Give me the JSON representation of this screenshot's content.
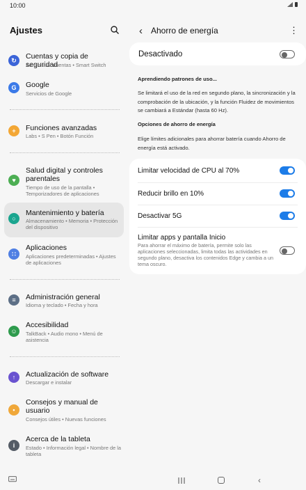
{
  "status": {
    "time": "10:00"
  },
  "left": {
    "title": "Ajustes",
    "items": [
      {
        "title": "Cuentas y copia de seguridad",
        "sub": "Administrar cuentas  •  Smart Switch",
        "color": "#3b64d8",
        "icon": "sync-icon"
      },
      {
        "title": "Google",
        "sub": "Servicios de Google",
        "color": "#3b7ae8",
        "icon": "google-icon"
      },
      {
        "title": "Funciones avanzadas",
        "sub": "Labs  •  S Pen  •  Botón Función",
        "color": "#f3a735",
        "icon": "gear-plus-icon"
      },
      {
        "title": "Salud digital y controles parentales",
        "sub": "Tiempo de uso de la pantalla  •  Temporizadores de aplicaciones",
        "color": "#4cae53",
        "icon": "heart-icon"
      },
      {
        "title": "Mantenimiento y batería",
        "sub": "Almacenamiento  •  Memoria  •  Protección del dispositivo",
        "color": "#1aa58f",
        "icon": "refresh-icon"
      },
      {
        "title": "Aplicaciones",
        "sub": "Aplicaciones predeterminadas  •  Ajustes de aplicaciones",
        "color": "#4f7fe3",
        "icon": "apps-grid-icon"
      },
      {
        "title": "Administración general",
        "sub": "Idioma y teclado  •  Fecha y hora",
        "color": "#5d6f86",
        "icon": "sliders-icon"
      },
      {
        "title": "Accesibilidad",
        "sub": "TalkBack  •  Audio mono  •  Menú de asistencia",
        "color": "#2e9b4d",
        "icon": "accessibility-icon"
      },
      {
        "title": "Actualización de software",
        "sub": "Descargar e instalar",
        "color": "#6a53d0",
        "icon": "software-update-icon"
      },
      {
        "title": "Consejos y manual de usuario",
        "sub": "Consejos útiles  •  Nuevas funciones",
        "color": "#f0a83a",
        "icon": "lightbulb-icon"
      },
      {
        "title": "Acerca de la tableta",
        "sub": "Estado  •  Información legal  •  Nombre de la tableta",
        "color": "#555c66",
        "icon": "info-icon"
      }
    ]
  },
  "right": {
    "title": "Ahorro de energía",
    "master_label": "Desactivado",
    "learning_head": "Aprendiendo patrones de uso...",
    "learning_text": "Se limitará el uso de la red en segundo plano, la sincronización y la comprobación de la ubicación, y la función Fluidez de movimientos se cambiará a Estándar (hasta 60 Hz).",
    "options_head": "Opciones de ahorro de energía",
    "options_text": "Elige límites adicionales para ahorrar batería cuando Ahorro de energía está activado.",
    "opt1": "Limitar velocidad de CPU al 70%",
    "opt2": "Reducir brillo en 10%",
    "opt3": "Desactivar 5G",
    "opt4": "Limitar apps y pantalla Inicio",
    "opt4_sub": "Para ahorrar el máximo de batería, permite solo las aplicaciones seleccionadas, limita todas las actividades en segundo plano, desactiva los contenidos Edge y cambia a un tema oscuro."
  }
}
